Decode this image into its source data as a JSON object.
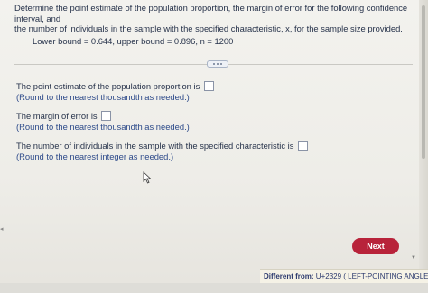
{
  "question": {
    "prompt_line1": "Determine the point estimate of the population proportion, the margin of error for the following confidence interval, and",
    "prompt_line2": "the number of individuals in the sample with the specified characteristic, x, for the sample size provided.",
    "bounds": "Lower bound = 0.644, upper bound = 0.896, n = 1200"
  },
  "parts": [
    {
      "label": "The point estimate of the population proportion is",
      "hint": "(Round to the nearest thousandth as needed.)"
    },
    {
      "label": "The margin of error is",
      "hint": "(Round to the nearest thousandth as needed.)"
    },
    {
      "label": "The number of individuals in the sample with the specified characteristic is",
      "hint": "(Round to the nearest integer as needed.)"
    }
  ],
  "actions": {
    "next_label": "Next"
  },
  "tooltip": {
    "prefix": "Different from:",
    "text": "U+2329 ( LEFT-POINTING ANGLE"
  },
  "colors": {
    "next_button": "#b8233a",
    "hint_text": "#2d4a8a"
  },
  "icons": {
    "more": "ellipsis-icon",
    "pointer": "mouse-cursor-icon"
  }
}
